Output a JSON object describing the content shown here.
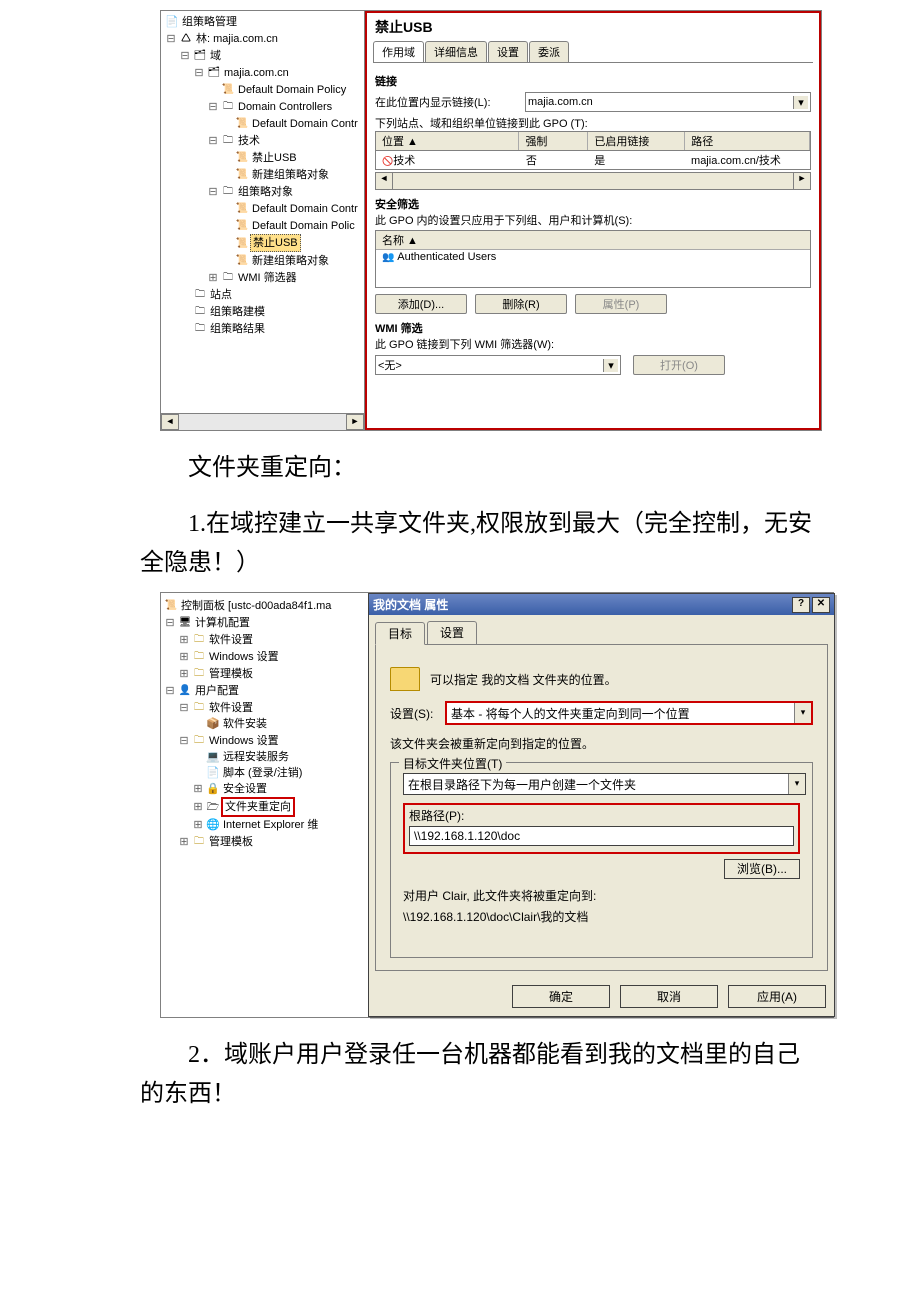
{
  "gpmc": {
    "title_prefix": "组策略管理",
    "tree": {
      "forest": "林: majia.com.cn",
      "domains": "域",
      "domain": "majia.com.cn",
      "ddp": "Default Domain Policy",
      "dc": "Domain Controllers",
      "ddc": "Default Domain Contr",
      "ou_tech": "技术",
      "gpo_ban_usb": "禁止USB",
      "gpo_new": "新建组策略对象",
      "gpo_objects": "组策略对象",
      "ddc2": "Default Domain Contr",
      "ddp2": "Default Domain Polic",
      "ban_usb_sel": "禁止USB",
      "gpo_new2": "新建组策略对象",
      "wmi": "WMI 筛选器",
      "sites": "站点",
      "modeling": "组策略建模",
      "results": "组策略结果"
    },
    "right": {
      "heading": "禁止USB",
      "tabs": {
        "scope": "作用域",
        "details": "详细信息",
        "settings": "设置",
        "deleg": "委派"
      },
      "links_hdr": "链接",
      "links_loc_label": "在此位置内显示链接(L):",
      "links_loc_value": "majia.com.cn",
      "linked_label": "下列站点、域和组织单位链接到此 GPO (T):",
      "cols": {
        "loc": "位置 ▲",
        "enforced": "强制",
        "enabled": "已启用链接",
        "path": "路径"
      },
      "row": {
        "loc": "技术",
        "enforced": "否",
        "enabled": "是",
        "path": "majia.com.cn/技术",
        "icon": "🔵"
      },
      "sec_hdr": "安全筛选",
      "sec_desc": "此 GPO 内的设置只应用于下列组、用户和计算机(S):",
      "sec_col": "名称 ▲",
      "sec_entry": "Authenticated Users",
      "btn_add": "添加(D)...",
      "btn_remove": "删除(R)",
      "btn_props": "属性(P)",
      "wmi_hdr": "WMI 筛选",
      "wmi_desc": "此 GPO 链接到下列 WMI 筛选器(W):",
      "wmi_value": "<无>",
      "wmi_open": "打开(O)"
    }
  },
  "text": {
    "p1": "文件夹重定向：",
    "p2": "1.在域控建立一共享文件夹,权限放到最大（完全控制，无安全隐患！）",
    "p3": "2．域账户用户登录任一台机器都能看到我的文档里的自己的东西！"
  },
  "mmc2": {
    "tree": {
      "root": "控制面板 [ustc-d00ada84f1.ma",
      "comp": "计算机配置",
      "soft": "软件设置",
      "winset": "Windows 设置",
      "admtpl": "管理模板",
      "user": "用户配置",
      "soft2": "软件设置",
      "softinst": "软件安装",
      "winset2": "Windows 设置",
      "ris": "远程安装服务",
      "scripts": "脚本 (登录/注销)",
      "sec": "安全设置",
      "folder_redir": "文件夹重定向",
      "ie": "Internet Explorer 维",
      "admtpl2": "管理模板"
    },
    "dlg": {
      "title": "我的文档 属性",
      "tab_target": "目标",
      "tab_settings": "设置",
      "desc": "可以指定 我的文档 文件夹的位置。",
      "setting_label": "设置(S):",
      "setting_value": "基本 - 将每个人的文件夹重定向到同一个位置",
      "note": "该文件夹会被重新定向到指定的位置。",
      "groupbox": "目标文件夹位置(T)",
      "target_combo": "在根目录路径下为每一用户创建一个文件夹",
      "rootpath_label": "根路径(P):",
      "rootpath_value": "\\\\192.168.1.120\\doc",
      "browse": "浏览(B)...",
      "redir_label": "对用户 Clair, 此文件夹将被重定向到:",
      "redir_value": "\\\\192.168.1.120\\doc\\Clair\\我的文档",
      "ok": "确定",
      "cancel": "取消",
      "apply": "应用(A)"
    }
  }
}
